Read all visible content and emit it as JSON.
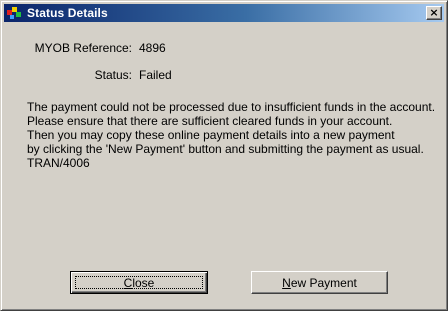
{
  "window": {
    "title": "Status Details",
    "close_glyph": "×"
  },
  "fields": {
    "reference_label": "MYOB Reference:",
    "reference_value": "4896",
    "status_label": "Status:",
    "status_value": "Failed"
  },
  "message": {
    "lines": [
      "The payment could not be processed due to insufficient funds in the account.",
      "Please ensure that there are sufficient cleared funds in your account.",
      "Then you may copy these online payment details into a new payment",
      "by clicking the 'New Payment' button and submitting the payment as usual.",
      "TRAN/4006"
    ]
  },
  "buttons": {
    "close_accel": "C",
    "close_rest": "lose",
    "new_accel": "N",
    "new_rest": "ew Payment"
  },
  "icons": {
    "app": "myob-app-icon",
    "close": "close-icon"
  }
}
